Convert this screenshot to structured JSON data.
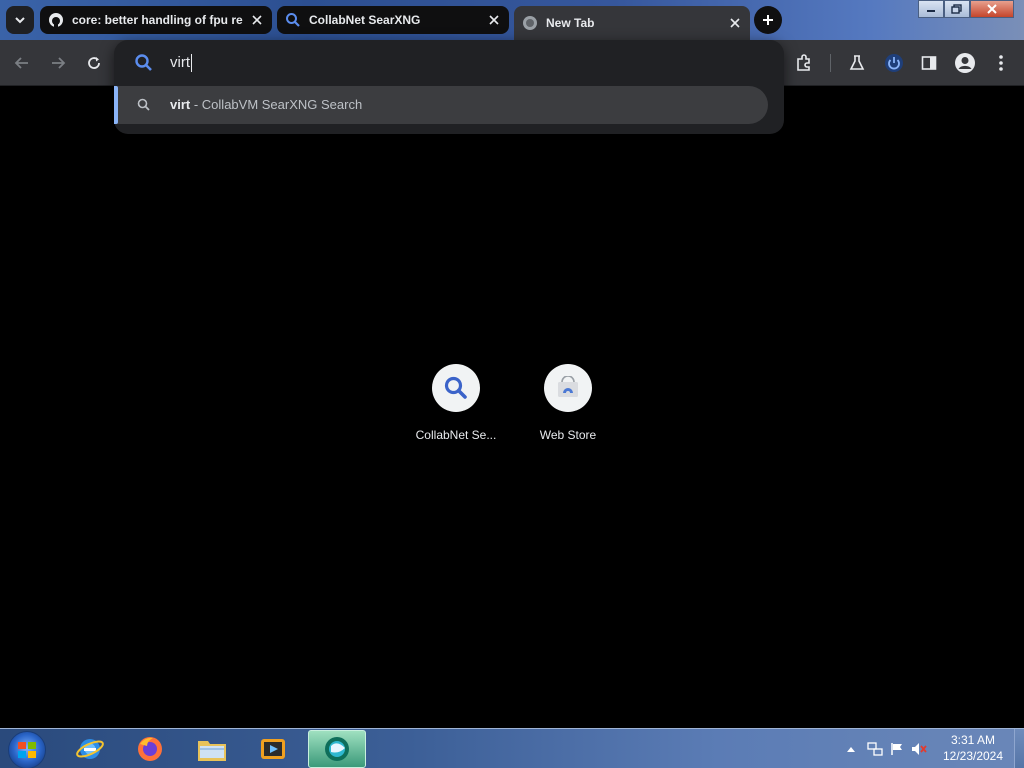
{
  "tabs": [
    {
      "title": "core: better handling of fpu re",
      "favicon": "github-icon",
      "active": false
    },
    {
      "title": "CollabNet SearXNG",
      "favicon": "search-icon",
      "active": false
    },
    {
      "title": "New Tab",
      "favicon": "globe-icon",
      "active": true
    }
  ],
  "omnibox": {
    "text": "virt",
    "suggestion": {
      "query": "virt",
      "separator": " - ",
      "engine_label": "CollabVM SearXNG Search"
    }
  },
  "shortcuts": [
    {
      "label": "CollabNet Se...",
      "icon": "search-icon"
    },
    {
      "label": "Web Store",
      "icon": "webstore-icon"
    }
  ],
  "toolbar_icons": [
    "back-icon",
    "forward-icon",
    "reload-icon",
    "extensions-icon",
    "labs-icon",
    "power-icon",
    "side-panel-icon",
    "profile-icon",
    "menu-icon"
  ],
  "taskbar": {
    "apps": [
      "internet-explorer-icon",
      "firefox-icon",
      "file-explorer-icon",
      "media-player-icon",
      "chrome-app-icon"
    ],
    "clock": {
      "time": "3:31 AM",
      "date": "12/23/2024"
    }
  },
  "colors": {
    "toolbar_bg": "#35363a",
    "omnibox_bg": "#202124",
    "suggestion_highlight": "#8ab4f8",
    "accent_blue": "#3b63c9"
  }
}
